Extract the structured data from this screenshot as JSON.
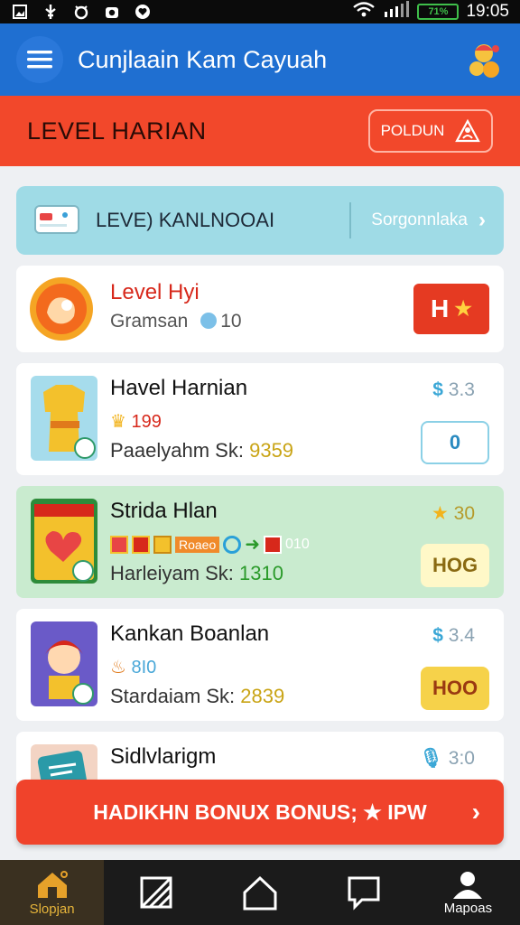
{
  "status_bar": {
    "time": "19:05",
    "battery": "71%"
  },
  "app_bar": {
    "title": "Cunjlaain Kam Cayuah"
  },
  "level_banner": {
    "title": "LEVEL HARIAN",
    "button_label": "POLDUN"
  },
  "info_row": {
    "label": "LEVE) KANLNOOAI",
    "link": "Sorgonnlaka"
  },
  "cards": [
    {
      "title": "Level Hyi",
      "subtitle": "Gramsan",
      "count": "10",
      "button": "H"
    },
    {
      "title": "Havel Harnian",
      "line": "199",
      "sub_label": "Paaelyahm Sk:",
      "sub_value": "9359",
      "price": "3.3",
      "button": "0"
    },
    {
      "title": "Strida Hlan",
      "tags": "Roaeo",
      "tag_suffix": "010",
      "sub_label": "Harleiyam Sk:",
      "sub_value": "1310",
      "price": "30",
      "button": "HOG"
    },
    {
      "title": "Kankan Boanlan",
      "line": "8I0",
      "sub_label": "Stardaiam Sk:",
      "sub_value": "2839",
      "price": "3.4",
      "button": "HOO"
    },
    {
      "title": "Sidlvlarigm",
      "price": "3:0"
    }
  ],
  "bonus_button": {
    "label": "HADIKHN BONUX BONUS; ★ IPW"
  },
  "bottom_nav": [
    {
      "label": "Slopjan",
      "icon": "home-icon"
    },
    {
      "label": "",
      "icon": "layers-icon"
    },
    {
      "label": "",
      "icon": "house-outline-icon"
    },
    {
      "label": "",
      "icon": "chat-icon"
    },
    {
      "label": "Mapoas",
      "icon": "profile-icon"
    }
  ],
  "colors": {
    "primary": "#1f6fd1",
    "accent_red": "#f2482b",
    "info_cyan": "#9fdbe6",
    "green_card": "#c9ebcf"
  }
}
